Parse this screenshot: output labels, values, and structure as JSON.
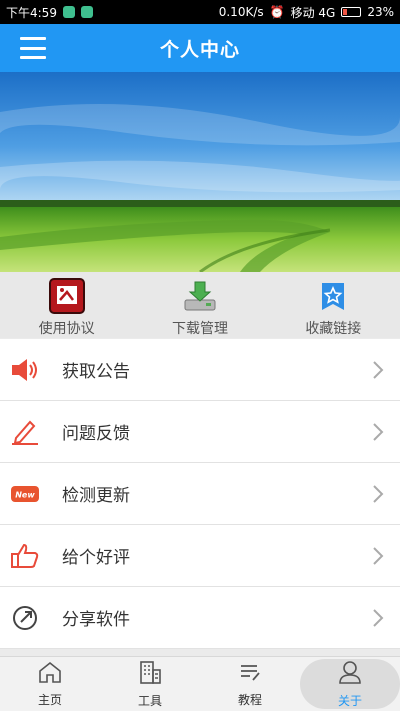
{
  "status_bar": {
    "time": "下午4:59",
    "network_speed": "0.10K/s",
    "carrier": "移动 4G",
    "battery": "23%"
  },
  "header": {
    "title": "个人中心",
    "menu_icon": "hamburger-menu-icon"
  },
  "quick_actions": [
    {
      "label": "使用协议",
      "icon": "agreement-icon"
    },
    {
      "label": "下载管理",
      "icon": "download-icon"
    },
    {
      "label": "收藏链接",
      "icon": "bookmark-star-icon"
    }
  ],
  "menu": [
    {
      "label": "获取公告",
      "icon": "speaker-icon"
    },
    {
      "label": "问题反馈",
      "icon": "pencil-icon"
    },
    {
      "label": "检测更新",
      "icon": "new-badge-icon",
      "badge_text": "New"
    },
    {
      "label": "给个好评",
      "icon": "thumbs-up-icon"
    },
    {
      "label": "分享软件",
      "icon": "share-icon"
    }
  ],
  "bottom_nav": [
    {
      "label": "主页",
      "icon": "home-icon"
    },
    {
      "label": "工具",
      "icon": "building-icon"
    },
    {
      "label": "教程",
      "icon": "notes-icon"
    },
    {
      "label": "关于",
      "icon": "user-icon",
      "active": true
    }
  ],
  "colors": {
    "primary": "#2197f3",
    "active_nav": "#2197f3"
  }
}
